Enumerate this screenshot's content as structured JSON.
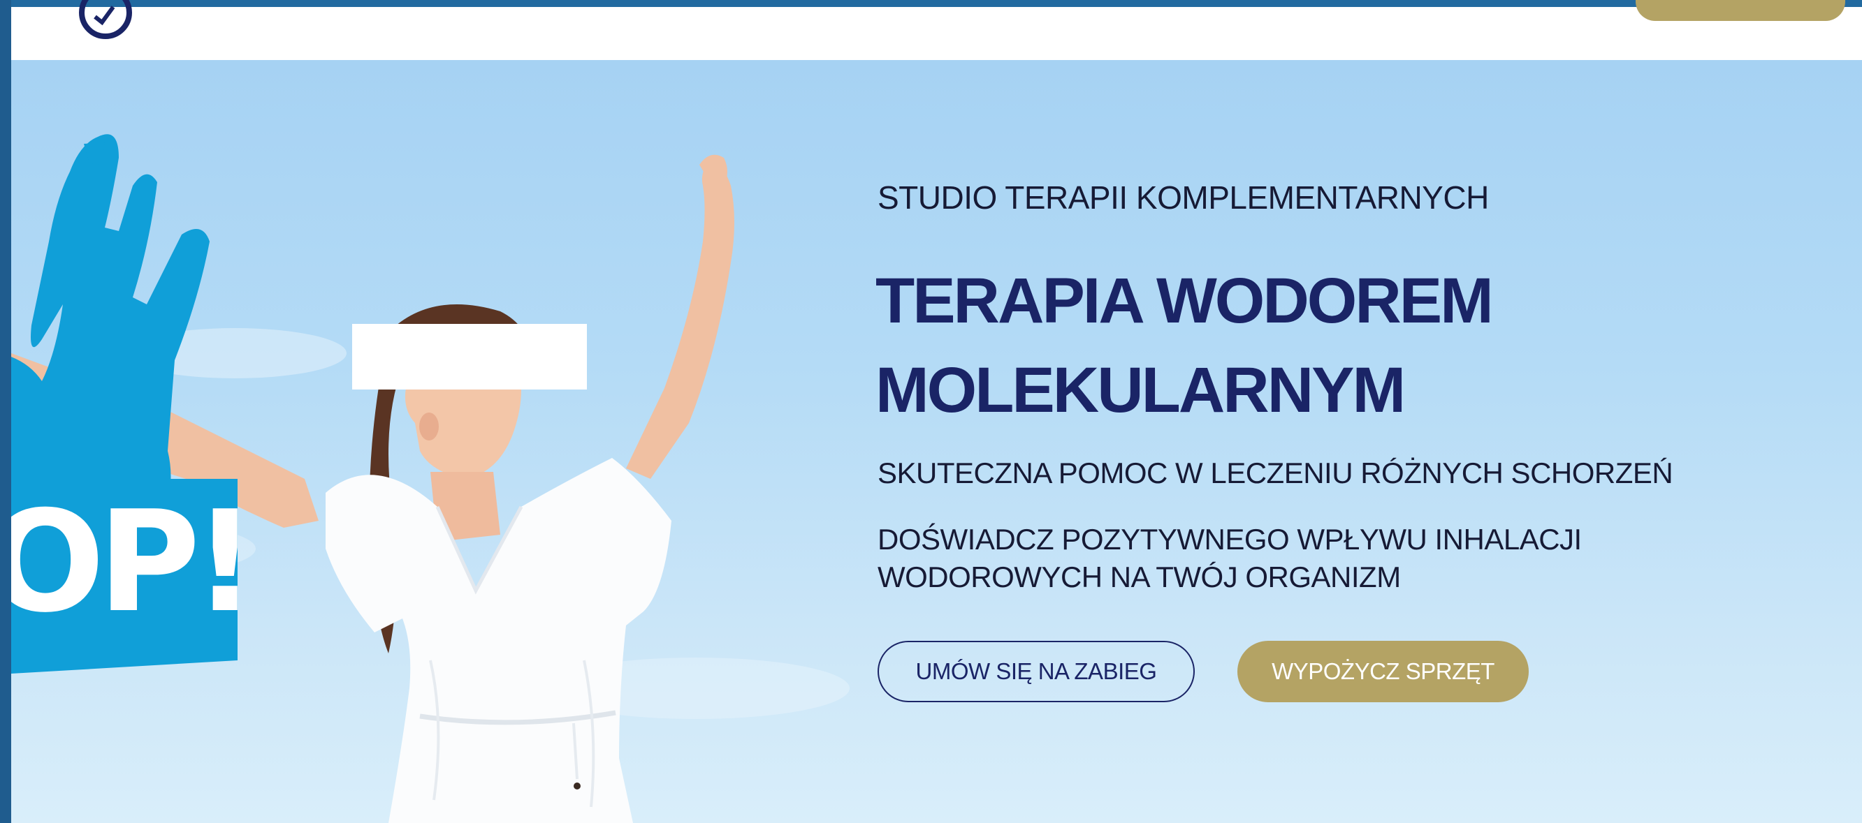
{
  "hero": {
    "eyebrow": "STUDIO TERAPII KOMPLEMENTARNYCH",
    "headline_line1": "TERAPIA WODOREM",
    "headline_line2": "MOLEKULARNYM",
    "subheading": "SKUTECZNA POMOC W LECZENIU RÓŻNYCH SCHORZEŃ",
    "description": "DOŚWIADCZ POZYTYWNEGO WPŁYWU INHALACJI WODOROWYCH NA TWÓJ ORGANIZM",
    "book_button": "UMÓW SIĘ NA ZABIEG",
    "rent_button": "WYPOŻYCZ SPRZĘT",
    "sticker_text": "OP!"
  },
  "colors": {
    "navy": "#1a2466",
    "gold": "#b4a364",
    "sky": "#a6d2f3",
    "sticker_blue": "#109fd8"
  },
  "icons": {
    "logo": "circular-logo-icon",
    "sticker": "blue-hand-sticker"
  }
}
